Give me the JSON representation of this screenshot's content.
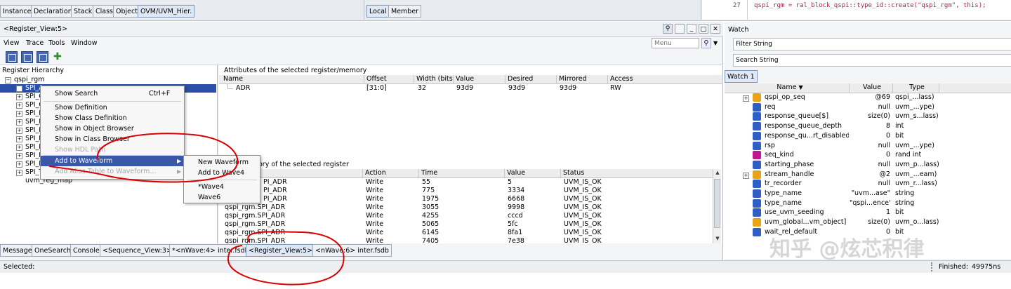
{
  "top_tabs": [
    "Instance",
    "Declaration",
    "Stack",
    "Class",
    "Object",
    "OVM/UVM_Hier."
  ],
  "top_tabs2": [
    "Local",
    "Member"
  ],
  "code": {
    "line_no": "27",
    "text": "qspi_rgm = ral_block_qspi::type_id::create(\"qspi_rgm\", this);"
  },
  "window_title": "<Register_View:5>",
  "menubar": [
    "View",
    "Trace",
    "Tools",
    "Window"
  ],
  "search": {
    "placeholder": "Menu"
  },
  "hierarchy": {
    "title": "Register Hierarchy",
    "root": "qspi_rgm",
    "items": [
      "SPI_A",
      "SPI_C",
      "SPI_C",
      "SPI_I",
      "SPI_I",
      "SPI_I",
      "SPI_I",
      "SPI_I",
      "SPI_I",
      "SPI_I",
      "SPI_T"
    ],
    "last": "uvm_reg_map"
  },
  "attributes": {
    "title": "Attributes of the selected register/memory",
    "columns": [
      "Name",
      "Offset",
      "Width (bits)",
      "Value",
      "Desired",
      "Mirrored",
      "Access"
    ],
    "rows": [
      [
        "ADR",
        "[31:0]",
        "32",
        "93d9",
        "93d9",
        "93d9",
        "RW"
      ]
    ]
  },
  "history": {
    "title": "History of the selected register",
    "title_visible": "ory of the selected register",
    "columns": [
      "",
      "Action",
      "Time",
      "Value",
      "Status"
    ],
    "rows": [
      [
        "PI_ADR",
        "Write",
        "55",
        "5",
        "UVM_IS_OK"
      ],
      [
        "PI_ADR",
        "Write",
        "775",
        "3334",
        "UVM_IS_OK"
      ],
      [
        "PI_ADR",
        "Write",
        "1975",
        "6668",
        "UVM_IS_OK"
      ],
      [
        "qspi_rgm.SPI_ADR",
        "Write",
        "3055",
        "9998",
        "UVM_IS_OK"
      ],
      [
        "qspi_rgm.SPI_ADR",
        "Write",
        "4255",
        "cccd",
        "UVM_IS_OK"
      ],
      [
        "qspi_rgm.SPI_ADR",
        "Write",
        "5065",
        "5fc",
        "UVM_IS_OK"
      ],
      [
        "qspi_rgm.SPI_ADR",
        "Write",
        "6145",
        "8fa1",
        "UVM_IS_OK"
      ],
      [
        "qspi_rgm.SPI_ADR",
        "Write",
        "7405",
        "7e38",
        "UVM_IS_OK"
      ]
    ]
  },
  "context_menu": {
    "items": [
      {
        "label": "Show Search",
        "shortcut": "Ctrl+F"
      },
      {
        "label": "Show Definition"
      },
      {
        "label": "Show Class Definition"
      },
      {
        "label": "Show in Object Browser"
      },
      {
        "label": "Show in Class Browser"
      },
      {
        "label": "Show HDL Path"
      },
      {
        "label": "Add to Waveform"
      },
      {
        "label": "Add Alias Table to Waveform..."
      }
    ]
  },
  "submenu": {
    "items": [
      "New Waveform",
      "Add to Wave4",
      "*Wave4",
      "Wave6"
    ]
  },
  "bottom_tabs": [
    "Message",
    "OneSearch",
    "Console",
    "<Sequence_View:3>",
    "*<nWave:4> inter.fsdb",
    "<Register_View:5>",
    "<nWave:6> inter.fsdb"
  ],
  "status": {
    "left": "Selected:",
    "finished": "Finished:",
    "time": "49975ns"
  },
  "watch": {
    "title": "Watch",
    "filter": "Filter String",
    "search": "Search String",
    "tab": "Watch 1",
    "columns": [
      "Name",
      "Value",
      "Type"
    ],
    "rows": [
      {
        "name": "qspi_op_seq",
        "value": "@69",
        "type": "qspi_...lass)",
        "expand": true,
        "icon": "orange"
      },
      {
        "name": "req",
        "value": "null",
        "type": "uvm_...ype)",
        "expand": false,
        "icon": "blue"
      },
      {
        "name": "response_queue[$]",
        "value": "size(0)",
        "type": "uvm_s...lass)",
        "expand": false,
        "icon": "blue"
      },
      {
        "name": "response_queue_depth",
        "value": "8",
        "type": "int",
        "expand": false,
        "icon": "blue"
      },
      {
        "name": "response_qu...rt_disabled",
        "value": "0",
        "type": "bit",
        "expand": false,
        "icon": "blue"
      },
      {
        "name": "rsp",
        "value": "null",
        "type": "uvm_...ype)",
        "expand": false,
        "icon": "blue"
      },
      {
        "name": "seq_kind",
        "value": "0",
        "type": "rand int",
        "expand": false,
        "icon": "magenta"
      },
      {
        "name": "starting_phase",
        "value": "null",
        "type": "uvm_p...lass)",
        "expand": false,
        "icon": "blue"
      },
      {
        "name": "stream_handle",
        "value": "@2",
        "type": "uvm_...eam)",
        "expand": true,
        "icon": "orange"
      },
      {
        "name": "tr_recorder",
        "value": "null",
        "type": "uvm_r...lass)",
        "expand": false,
        "icon": "blue"
      },
      {
        "name": "type_name",
        "value": "\"uvm...ase\"",
        "type": "string",
        "expand": false,
        "icon": "blue"
      },
      {
        "name": "type_name",
        "value": "\"qspi...ence\"",
        "type": "string",
        "expand": false,
        "icon": "blue"
      },
      {
        "name": "use_uvm_seeding",
        "value": "1",
        "type": "bit",
        "expand": false,
        "icon": "blue"
      },
      {
        "name": "uvm_global...vm_object]",
        "value": "size(0)",
        "type": "uvm_o...lass)",
        "expand": false,
        "icon": "orange"
      },
      {
        "name": "wait_rel_default",
        "value": "0",
        "type": "bit",
        "expand": false,
        "icon": "blue"
      }
    ]
  },
  "watermark": "知乎 @炫芯积律",
  "colors": {
    "accent": "#3a57a8",
    "selected_row": "#2b4fa8",
    "annotation": "#d80000"
  }
}
